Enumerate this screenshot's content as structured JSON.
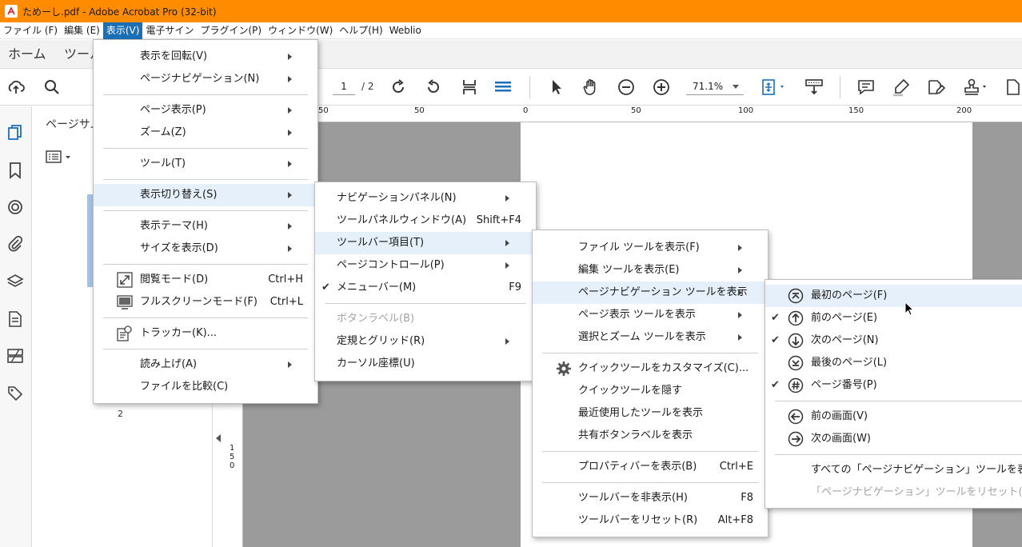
{
  "window": {
    "title": "ためーし.pdf - Adobe Acrobat Pro (32-bit)"
  },
  "menubar": {
    "items": [
      "ファイル (F)",
      "編集 (E)",
      "表示(V)",
      "電子サイン",
      "プラグイン(P)",
      "ウィンドウ(W)",
      "ヘルプ(H)",
      "Weblio"
    ],
    "active_index": 2
  },
  "tabs": {
    "home": "ホーム",
    "tools": "ツール"
  },
  "toolbar": {
    "page_current": "1",
    "page_total": "/ 2",
    "zoom": "71.1%"
  },
  "panel": {
    "title": "ページサム",
    "page_label": "2"
  },
  "rulers": {
    "h_labels": [
      "50",
      "0",
      "50",
      "100",
      "150",
      "200"
    ],
    "v_labels": [
      "1",
      "5",
      "0"
    ]
  },
  "view_menu": {
    "items": [
      {
        "label": "表示を回転(V)",
        "submenu": true
      },
      {
        "label": "ページナビゲーション(N)",
        "submenu": true
      },
      {
        "label": "ページ表示(P)",
        "submenu": true
      },
      {
        "label": "ズーム(Z)",
        "submenu": true
      },
      {
        "label": "ツール(T)",
        "submenu": true
      },
      {
        "label": "表示切り替え(S)",
        "submenu": true
      },
      {
        "label": "表示テーマ(H)",
        "submenu": true
      },
      {
        "label": "サイズを表示(D)",
        "submenu": true
      },
      {
        "label": "閲覧モード(D)",
        "shortcut": "Ctrl+H",
        "icon": "reading-mode-icon"
      },
      {
        "label": "フルスクリーンモード(F)",
        "shortcut": "Ctrl+L",
        "icon": "fullscreen-icon"
      },
      {
        "label": "トラッカー(K)...",
        "icon": "tracker-icon"
      },
      {
        "label": "読み上げ(A)",
        "submenu": true
      },
      {
        "label": "ファイルを比較(C)"
      }
    ]
  },
  "show_hide_menu": {
    "items": [
      {
        "label": "ナビゲーションパネル(N)",
        "submenu": true
      },
      {
        "label": "ツールパネルウィンドウ(A)",
        "shortcut": "Shift+F4"
      },
      {
        "label": "ツールバー項目(T)",
        "submenu": true
      },
      {
        "label": "ページコントロール(P)",
        "submenu": true
      },
      {
        "label": "メニューバー(M)",
        "shortcut": "F9",
        "checked": true
      },
      {
        "label": "ボタンラベル(B)",
        "disabled": true
      },
      {
        "label": "定規とグリッド(R)",
        "submenu": true
      },
      {
        "label": "カーソル座標(U)"
      }
    ]
  },
  "toolbar_items_menu": {
    "items": [
      {
        "label": "ファイル ツールを表示(F)",
        "submenu": true
      },
      {
        "label": "編集 ツールを表示(E)",
        "submenu": true
      },
      {
        "label": "ページナビゲーション ツールを表示",
        "submenu": true
      },
      {
        "label": "ページ表示 ツールを表示",
        "submenu": true
      },
      {
        "label": "選択とズーム ツールを表示",
        "submenu": true
      },
      {
        "label": "クイックツールをカスタマイズ(C)...",
        "icon": "gear-icon"
      },
      {
        "label": "クイックツールを隠す"
      },
      {
        "label": "最近使用したツールを表示"
      },
      {
        "label": "共有ボタンラベルを表示"
      },
      {
        "label": "プロパティバーを表示(B)",
        "shortcut": "Ctrl+E"
      },
      {
        "label": "ツールバーを非表示(H)",
        "shortcut": "F8"
      },
      {
        "label": "ツールバーをリセット(R)",
        "shortcut": "Alt+F8"
      }
    ]
  },
  "page_nav_menu": {
    "items": [
      {
        "label": "最初のページ(F)",
        "icon": "first-page-icon"
      },
      {
        "label": "前のページ(E)",
        "icon": "previous-page-icon",
        "checked": true
      },
      {
        "label": "次のページ(N)",
        "icon": "next-page-icon",
        "checked": true
      },
      {
        "label": "最後のページ(L)",
        "icon": "last-page-icon"
      },
      {
        "label": "ページ番号(P)",
        "icon": "page-number-icon",
        "checked": true
      },
      {
        "label": "前の画面(V)",
        "icon": "previous-view-icon"
      },
      {
        "label": "次の画面(W)",
        "icon": "next-view-icon"
      },
      {
        "label": "すべての「ページナビゲーション」ツールを表示(H)"
      },
      {
        "label": "「ページナビゲーション」ツールをリセット(R)",
        "disabled": true
      }
    ]
  },
  "check_mark": "✔",
  "colors": {
    "titlebar": "#ff8c00",
    "menu_active": "#1b6fb7",
    "highlight": "#e5f0fb",
    "icon_blue": "#1b6fb7"
  }
}
